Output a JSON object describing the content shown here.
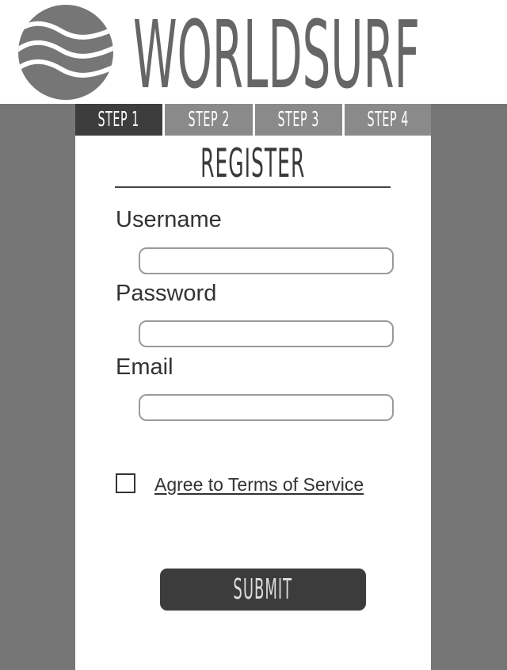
{
  "header": {
    "brand": "WORLDSURF",
    "logo_icon": "wave-globe-icon"
  },
  "steps": [
    {
      "label": "STEP 1",
      "active": true
    },
    {
      "label": "STEP 2",
      "active": false
    },
    {
      "label": "STEP 3",
      "active": false
    },
    {
      "label": "STEP 4",
      "active": false
    }
  ],
  "form": {
    "title": "REGISTER",
    "fields": {
      "username": {
        "label": "Username",
        "value": "",
        "placeholder": ""
      },
      "password": {
        "label": "Password",
        "value": "",
        "placeholder": ""
      },
      "email": {
        "label": "Email",
        "value": "",
        "placeholder": ""
      }
    },
    "terms": {
      "label": "Agree to Terms of Service",
      "checked": false
    },
    "submit_label": "SUBMIT"
  },
  "colors": {
    "side_band": "#767676",
    "active_step": "#3d3d3d",
    "inactive_step": "#8a8a8a",
    "button": "#3c3c3c",
    "brand_text": "#666666"
  }
}
